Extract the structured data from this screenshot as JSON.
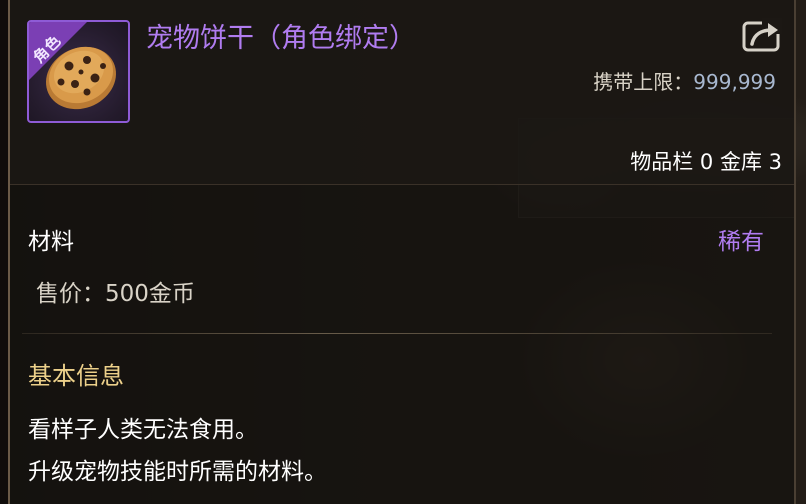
{
  "item": {
    "name": "宠物饼干（角色绑定）",
    "binding_badge": "角色",
    "carry_limit_label": "携带上限：",
    "carry_limit_value": "999,999",
    "storage": "物品栏 0 金库 3",
    "category": "材料",
    "rarity": "稀有",
    "price": "售价：500金币",
    "basic_info_title": "基本信息",
    "description": [
      "看样子人类无法食用。",
      "升级宠物技能时所需的材料。"
    ]
  },
  "icons": {
    "item_icon": "pet-cookie-icon",
    "share_icon": "share-icon"
  },
  "colors": {
    "title": "#b07cf0",
    "rarity": "#b07cf0",
    "section_title": "#ecd08a",
    "icon_border": "#8e5bd6",
    "panel_bg": "#1c1814"
  }
}
